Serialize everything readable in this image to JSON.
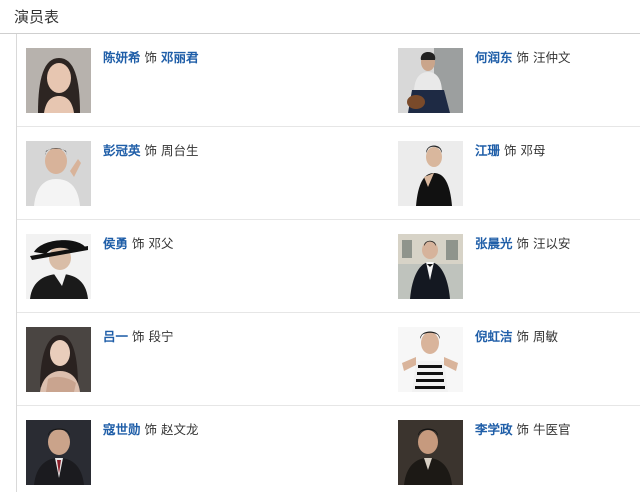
{
  "header": {
    "title": "演员表"
  },
  "as_label": "饰",
  "cast": [
    {
      "actor": "陈妍希",
      "role": "邓丽君",
      "role_linked": true,
      "photo": "actor-photo-woman-long-hair"
    },
    {
      "actor": "何润东",
      "role": "汪仲文",
      "role_linked": false,
      "photo": "actor-photo-man-seated-guitar"
    },
    {
      "actor": "彭冠英",
      "role": "周台生",
      "role_linked": false,
      "photo": "actor-photo-man-white-shirt"
    },
    {
      "actor": "江珊",
      "role": "邓母",
      "role_linked": false,
      "photo": "actor-photo-woman-black-dress"
    },
    {
      "actor": "侯勇",
      "role": "邓父",
      "role_linked": false,
      "photo": "actor-photo-man-black-hat"
    },
    {
      "actor": "张晨光",
      "role": "汪以安",
      "role_linked": false,
      "photo": "actor-photo-man-tuxedo"
    },
    {
      "actor": "吕一",
      "role": "段宁",
      "role_linked": false,
      "photo": "actor-photo-woman-dark-background"
    },
    {
      "actor": "倪虹洁",
      "role": "周敏",
      "role_linked": false,
      "photo": "actor-photo-woman-striped-top"
    },
    {
      "actor": "寇世勋",
      "role": "赵文龙",
      "role_linked": false,
      "photo": "actor-photo-man-dark-suit"
    },
    {
      "actor": "李学政",
      "role": "牛医官",
      "role_linked": false,
      "photo": "actor-photo-man-dark-jacket"
    }
  ]
}
